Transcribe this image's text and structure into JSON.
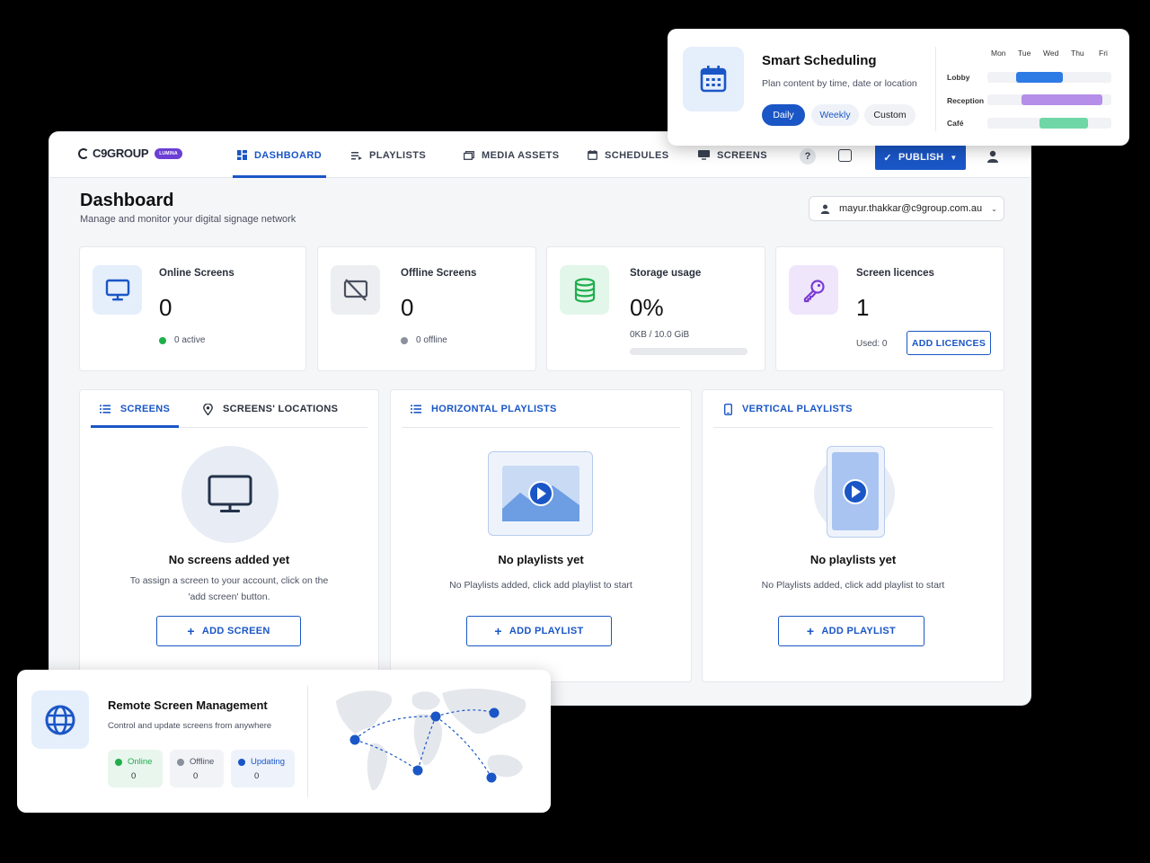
{
  "app": {
    "brand": "C9GROUP",
    "brand_badge": "LUMINA",
    "nav": [
      {
        "label": "DASHBOARD"
      },
      {
        "label": "PLAYLISTS"
      },
      {
        "label": "MEDIA ASSETS"
      },
      {
        "label": "SCHEDULES"
      },
      {
        "label": "SCREENS"
      }
    ],
    "help_label": "?",
    "publish_label": "PUBLISH"
  },
  "page": {
    "title": "Dashboard",
    "subtitle": "Manage and monitor your digital signage network",
    "account_email": "mayur.thakkar@c9group.com.au"
  },
  "stats": {
    "online": {
      "label": "Online Screens",
      "value": "0",
      "sub": "0 active",
      "dot_color": "#1fae4b"
    },
    "offline": {
      "label": "Offline Screens",
      "value": "0",
      "sub": "0 offline",
      "dot_color": "#8a909c"
    },
    "storage": {
      "label": "Storage usage",
      "value": "0%",
      "sub": "0KB / 10.0 GiB",
      "progress": 0
    },
    "licences": {
      "label": "Screen licences",
      "value": "1",
      "used": "Used: 0",
      "button": "ADD LICENCES"
    }
  },
  "panels": {
    "screens": {
      "tab1": "SCREENS",
      "tab2": "SCREENS' LOCATIONS",
      "empty_title": "No screens added yet",
      "empty_desc_1": "To assign a screen to your account, click on the",
      "empty_desc_2": "'add screen' button.",
      "button": "ADD SCREEN"
    },
    "horizontal": {
      "tab": "HORIZONTAL PLAYLISTS",
      "empty_title": "No playlists yet",
      "empty_desc": "No Playlists added, click add playlist to start",
      "button": "ADD PLAYLIST"
    },
    "vertical": {
      "tab": "VERTICAL PLAYLISTS",
      "empty_title": "No playlists yet",
      "empty_desc": "No Playlists added, click add playlist to start",
      "button": "ADD PLAYLIST"
    }
  },
  "scheduling": {
    "title": "Smart Scheduling",
    "desc": "Plan content by time, date or location",
    "options": [
      "Daily",
      "Weekly",
      "Custom"
    ],
    "days": [
      "Mon",
      "Tue",
      "Wed",
      "Thu",
      "Fri"
    ],
    "rows": [
      {
        "label": "Lobby",
        "color": "#2d7be5"
      },
      {
        "label": "Reception",
        "color": "#b48ee8"
      },
      {
        "label": "Café",
        "color": "#6fd6a6"
      }
    ]
  },
  "remote": {
    "title": "Remote Screen Management",
    "desc": "Control and update screens from anywhere",
    "statuses": [
      {
        "label": "Online",
        "value": "0",
        "color": "#1fae4b"
      },
      {
        "label": "Offline",
        "value": "0",
        "color": "#8a909c"
      },
      {
        "label": "Updating",
        "value": "0",
        "color": "#1a56c6"
      }
    ]
  },
  "colors": {
    "accent": "#1a56c6",
    "background": "#f5f6f8"
  }
}
